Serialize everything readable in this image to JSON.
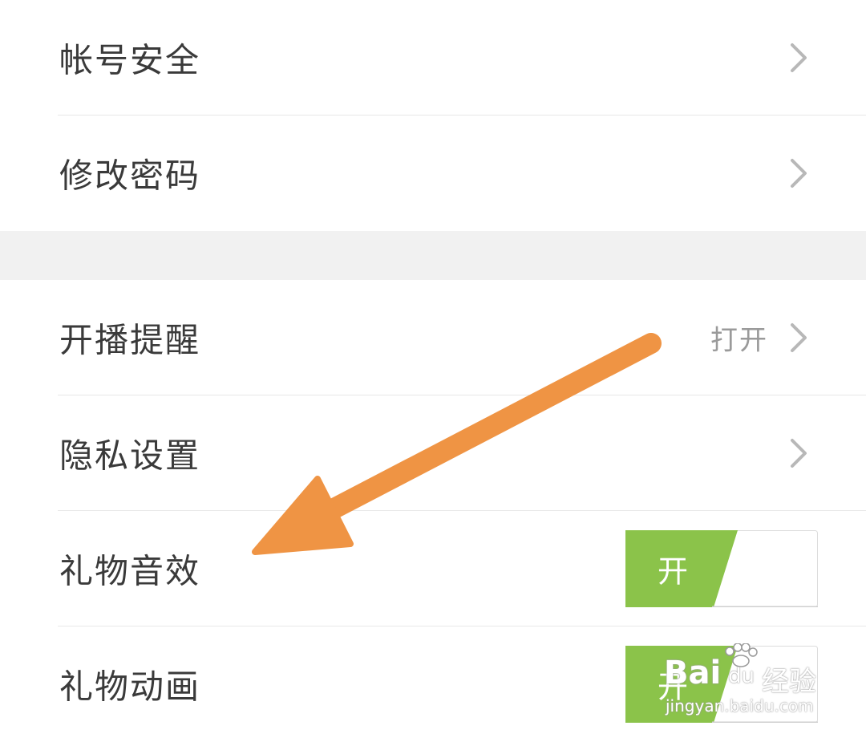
{
  "settings": {
    "account_security": "帐号安全",
    "change_password": "修改密码",
    "live_reminder": "开播提醒",
    "live_reminder_value": "打开",
    "privacy_settings": "隐私设置",
    "gift_sound": "礼物音效",
    "gift_sound_toggle": "开",
    "gift_animation": "礼物动画",
    "gift_animation_toggle": "开"
  },
  "colors": {
    "toggle_on": "#8bc34a",
    "annotation_arrow": "#ef9444"
  },
  "watermark": {
    "brand": "Bai",
    "brand_suffix": "du",
    "name": "经验",
    "site": "jingyan.baidu.com"
  }
}
